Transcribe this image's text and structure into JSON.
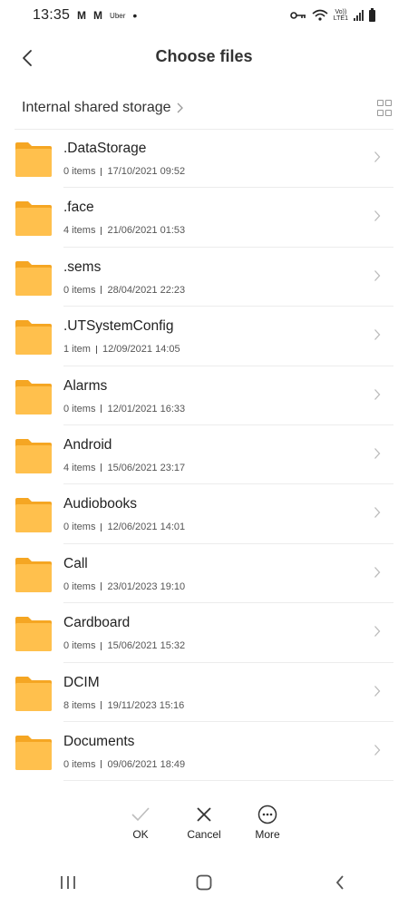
{
  "status_bar": {
    "time": "13:35",
    "app_icons": [
      "M",
      "M"
    ],
    "uber": "Uber",
    "dot": "•",
    "volte_top": "Vo))",
    "volte_bottom": "LTE1"
  },
  "header": {
    "title": "Choose files"
  },
  "path": {
    "breadcrumb": "Internal shared storage"
  },
  "colors": {
    "folder_front": "#FFC04D",
    "folder_back": "#F5A623",
    "divider": "#ECECEC"
  },
  "files": [
    {
      "name": ".DataStorage",
      "count": "0 items",
      "date": "17/10/2021 09:52"
    },
    {
      "name": ".face",
      "count": "4 items",
      "date": "21/06/2021 01:53"
    },
    {
      "name": ".sems",
      "count": "0 items",
      "date": "28/04/2021 22:23"
    },
    {
      "name": ".UTSystemConfig",
      "count": "1 item",
      "date": "12/09/2021 14:05"
    },
    {
      "name": "Alarms",
      "count": "0 items",
      "date": "12/01/2021 16:33"
    },
    {
      "name": "Android",
      "count": "4 items",
      "date": "15/06/2021 23:17"
    },
    {
      "name": "Audiobooks",
      "count": "0 items",
      "date": "12/06/2021 14:01"
    },
    {
      "name": "Call",
      "count": "0 items",
      "date": "23/01/2023 19:10"
    },
    {
      "name": "Cardboard",
      "count": "0 items",
      "date": "15/06/2021 15:32"
    },
    {
      "name": "DCIM",
      "count": "8 items",
      "date": "19/11/2023 15:16"
    },
    {
      "name": "Documents",
      "count": "0 items",
      "date": "09/06/2021 18:49"
    }
  ],
  "actions": {
    "ok": "OK",
    "cancel": "Cancel",
    "more": "More"
  }
}
